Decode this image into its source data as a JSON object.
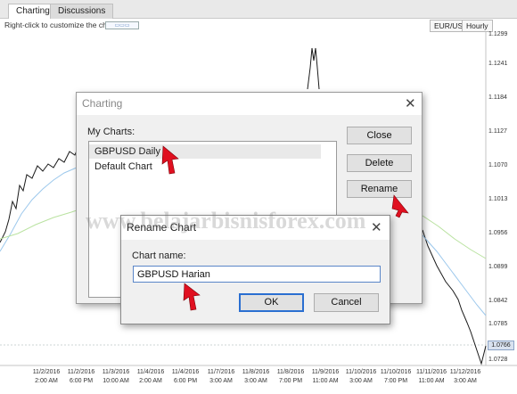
{
  "tabs": [
    {
      "label": "Charting",
      "active": true
    },
    {
      "label": "Discussions",
      "active": false
    }
  ],
  "hint": {
    "text": "Right-click to customize the chart"
  },
  "toolbar": {
    "symbol": "EUR/USD",
    "timeframe": "Hourly"
  },
  "chart_axis": {
    "y_ticks": [
      "1.1299",
      "1.1241",
      "1.1184",
      "1.1127",
      "1.1070",
      "1.1013",
      "1.0956",
      "1.0899",
      "1.0842",
      "1.0785",
      "1.0728"
    ],
    "current_price": "1.0766",
    "x_ticks": [
      {
        "date": "11/2/2016",
        "time": "2:00 AM"
      },
      {
        "date": "11/2/2016",
        "time": "6:00 PM"
      },
      {
        "date": "11/3/2016",
        "time": "10:00 AM"
      },
      {
        "date": "11/4/2016",
        "time": "2:00 AM"
      },
      {
        "date": "11/4/2016",
        "time": "6:00 PM"
      },
      {
        "date": "11/7/2016",
        "time": "3:00 AM"
      },
      {
        "date": "11/8/2016",
        "time": "3:00 AM"
      },
      {
        "date": "11/8/2016",
        "time": "7:00 PM"
      },
      {
        "date": "11/9/2016",
        "time": "11:00 AM"
      },
      {
        "date": "11/10/2016",
        "time": "3:00 AM"
      },
      {
        "date": "11/10/2016",
        "time": "7:00 PM"
      },
      {
        "date": "11/11/2016",
        "time": "11:00 AM"
      },
      {
        "date": "11/12/2016",
        "time": "3:00 AM"
      }
    ]
  },
  "charting_dialog": {
    "title": "Charting",
    "list_label": "My Charts:",
    "items": [
      {
        "label": "GBPUSD Daily",
        "selected": true
      },
      {
        "label": "Default Chart",
        "selected": false
      }
    ],
    "close_label": "Close",
    "delete_label": "Delete",
    "rename_label": "Rename"
  },
  "rename_dialog": {
    "title": "Rename Chart",
    "field_label": "Chart name:",
    "field_value": "GBPUSD Harian",
    "ok_label": "OK",
    "cancel_label": "Cancel"
  },
  "watermark": "www.belajarbisnisforex.com",
  "colors": {
    "accent": "#2a6fd1",
    "arrow": "#e01020",
    "ma_blue": "#9cc8ec",
    "ma_green": "#b9e2a0"
  }
}
